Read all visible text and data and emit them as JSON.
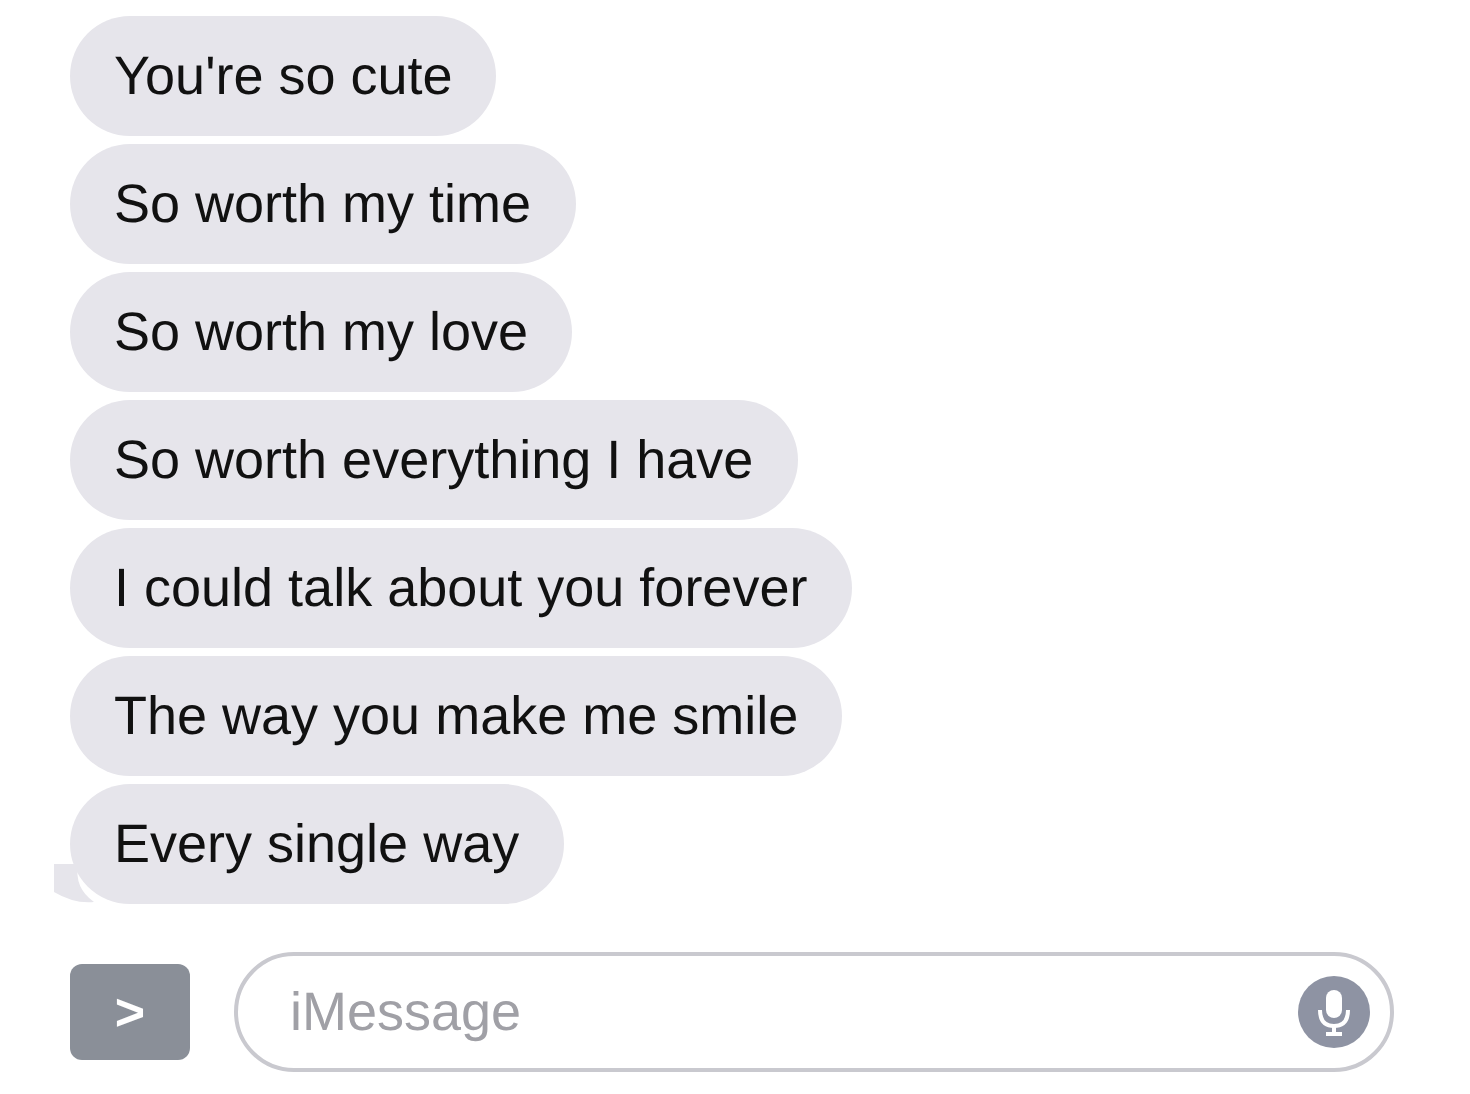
{
  "messages": [
    {
      "text": "You're so cute",
      "tail": false
    },
    {
      "text": "So worth my time",
      "tail": false
    },
    {
      "text": "So worth my love",
      "tail": false
    },
    {
      "text": "So worth everything I have",
      "tail": false
    },
    {
      "text": "I could talk about you forever",
      "tail": false
    },
    {
      "text": "The way you make me smile",
      "tail": false
    },
    {
      "text": "Every single way",
      "tail": true
    }
  ],
  "composer": {
    "expand_icon": ">",
    "placeholder": "iMessage"
  }
}
